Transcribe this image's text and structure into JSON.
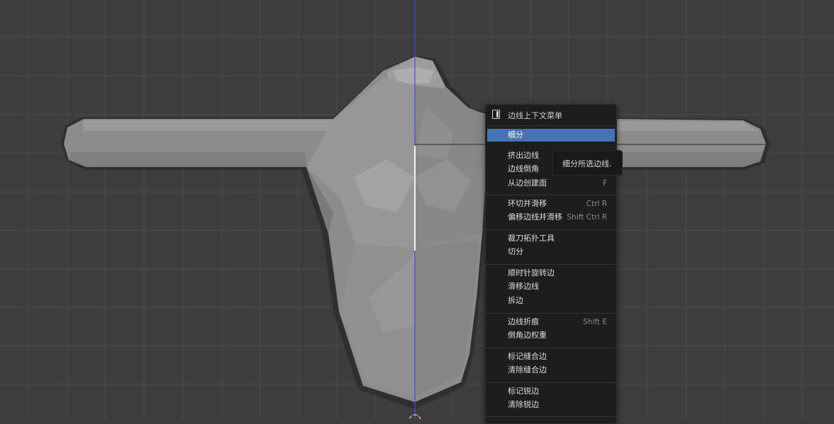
{
  "colors": {
    "viewport_bg": "#3d3d3d",
    "grid_line": "#4a4a4a",
    "menu_bg": "#1d1d1d",
    "highlight": "#4772b3",
    "axis_blue": "#3b5ea8"
  },
  "menu": {
    "header_icon": "edge-select-icon",
    "title": "边线上下文菜单",
    "items": [
      {
        "label": "细分",
        "shortcut": "",
        "active": true
      },
      {
        "label": "挤出边线",
        "shortcut": ""
      },
      {
        "label": "边线倒角",
        "shortcut": ""
      },
      {
        "label": "从边创建面",
        "shortcut": "F"
      },
      {
        "label": "环切并滑移",
        "shortcut": "Ctrl R"
      },
      {
        "label": "偏移边线并滑移",
        "shortcut": "Shift Ctrl R"
      },
      {
        "label": "裁刀拓扑工具",
        "shortcut": ""
      },
      {
        "label": "切分",
        "shortcut": ""
      },
      {
        "label": "顺时针旋转边",
        "shortcut": ""
      },
      {
        "label": "滑移边线",
        "shortcut": ""
      },
      {
        "label": "拆边",
        "shortcut": ""
      },
      {
        "label": "边线折痕",
        "shortcut": "Shift E"
      },
      {
        "label": "倒角边权重",
        "shortcut": ""
      },
      {
        "label": "标记缝合边",
        "shortcut": ""
      },
      {
        "label": "清除缝合边",
        "shortcut": ""
      },
      {
        "label": "标记锐边",
        "shortcut": ""
      },
      {
        "label": "清除锐边",
        "shortcut": ""
      }
    ]
  },
  "tooltip": {
    "text": "细分所选边线."
  }
}
